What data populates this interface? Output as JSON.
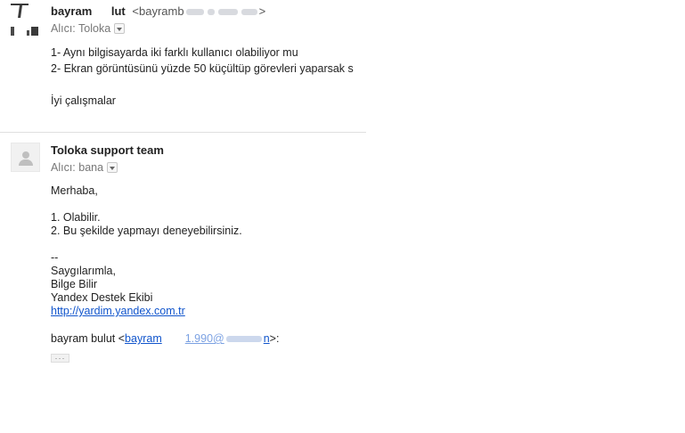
{
  "message1": {
    "sender_name": "bayram",
    "sender_name_fragment": "lut",
    "sender_email_prefix": "<bayramb",
    "sender_email_suffix": ">",
    "to_label": "Alıcı: Toloka",
    "body_lines": [
      "1- Aynı bilgisayarda iki farklı kullanıcı olabiliyor mu",
      "2- Ekran görüntüsünü yüzde 50 küçültüp görevleri yaparsak s",
      "",
      "İyi çalışmalar"
    ]
  },
  "message2": {
    "sender_name": "Toloka support team",
    "to_label": "Alıcı: bana",
    "greeting": "Merhaba,",
    "answers": [
      "1. Olabilir.",
      "2. Bu şekilde yapmayı deneyebilirsiniz."
    ],
    "signature": {
      "separator": "--",
      "closing": "Saygılarımla,",
      "name": "Bilge Bilir",
      "team": "Yandex Destek Ekibi",
      "link": "http://yardim.yandex.com.tr"
    },
    "quote": {
      "prefix": "bayram bulut <",
      "email_start": "bayram",
      "email_mid": "1.990@",
      "email_end": "n",
      "suffix": ">:"
    },
    "show_trimmed_label": "···"
  }
}
